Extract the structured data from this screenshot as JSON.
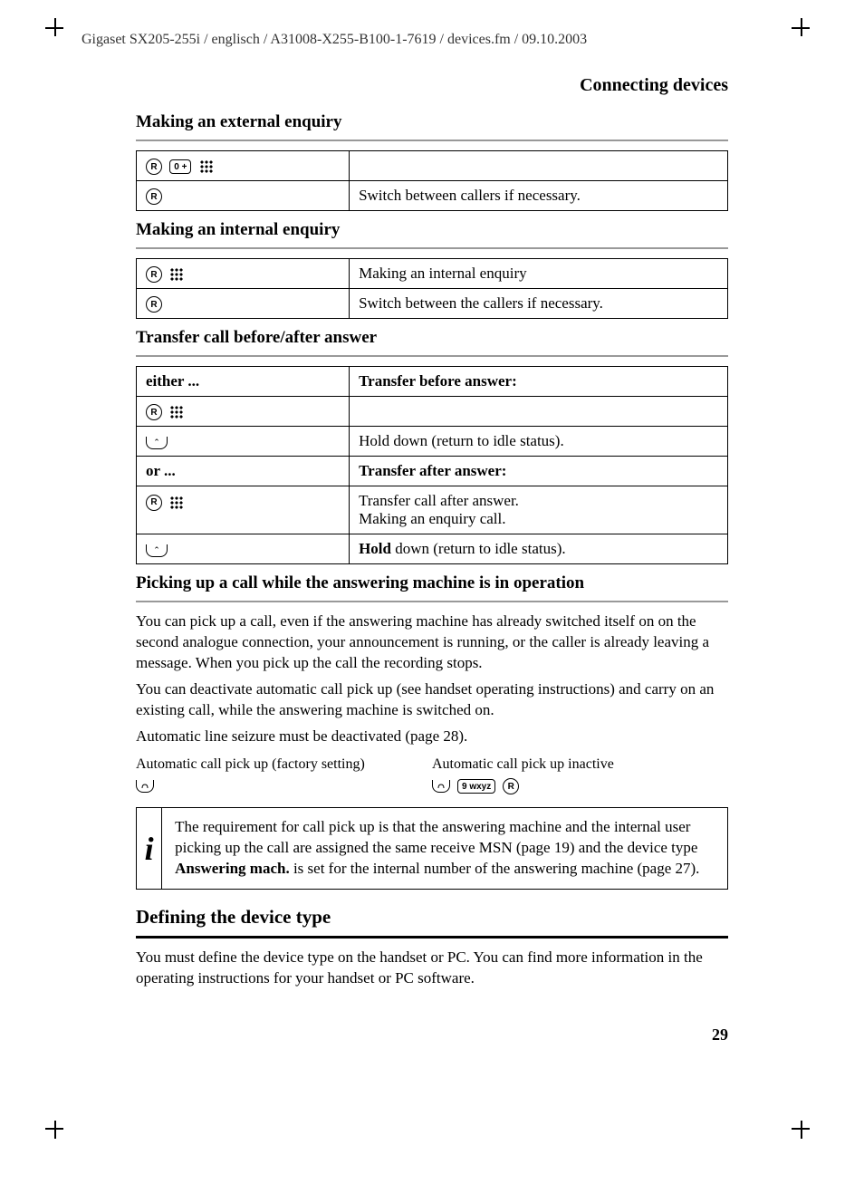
{
  "header_path": "Gigaset SX205-255i / englisch / A31008-X255-B100-1-7619 / devices.fm / 09.10.2003",
  "section_title": "Connecting devices",
  "s1": {
    "title": "Making an external enquiry",
    "r2c2": "Switch between callers if necessary."
  },
  "s2": {
    "title": "Making an internal enquiry",
    "r1c2": "Making an internal enquiry",
    "r2c2": "Switch between the callers if necessary."
  },
  "s3": {
    "title": "Transfer call before/after answer",
    "h1a": "either ...",
    "h1b": "Transfer before answer:",
    "r2c2": "Hold down (return to idle status).",
    "h2a": "or ...",
    "h2b": "Transfer after answer:",
    "r3c2a": "Transfer call after answer.",
    "r3c2b": "Making an enquiry call.",
    "r4c2_bold": "Hold",
    "r4c2": " down (return to idle status)."
  },
  "s4": {
    "title": "Picking up a call while the answering machine is in operation",
    "p1": "You can pick up a call, even if the answering machine has already switched itself on on the second analogue connection, your announcement is running, or the caller is already leaving a message. When you pick up the call the recording stops.",
    "p2": "You can deactivate automatic call pick up (see handset operating instructions) and carry on an existing call, while the answering machine is switched on.",
    "p3": "Automatic line seizure must be deactivated (page 28).",
    "col1": "Automatic call pick up (factory setting)",
    "col2": "Automatic call pick up inactive",
    "info_a": "The requirement for call pick up is that the answering machine and the internal user picking up the call are assigned the same receive MSN (page 19) and the device type ",
    "info_bold": "Answering mach.",
    "info_b": " is set for the internal number of the answering machine (page 27)."
  },
  "s5": {
    "title": "Defining the device type",
    "p1": "You must define the device type on the handset or PC. You can find more information in the operating instructions for your handset or PC software."
  },
  "page_number": "29",
  "keys": {
    "r": "R",
    "zero": "0 +",
    "nine": "9 wxyz"
  }
}
